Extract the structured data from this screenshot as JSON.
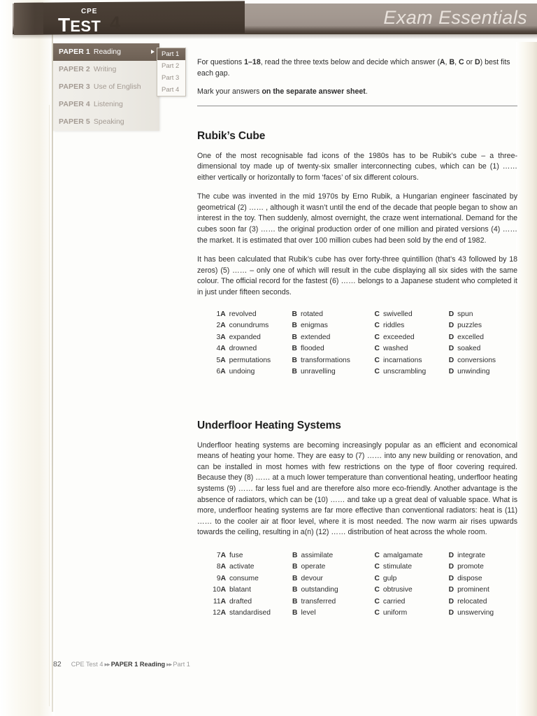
{
  "banner": {
    "cpe_label": "CPE",
    "test_word": "TEST",
    "test_number": "4",
    "title": "Exam Essentials"
  },
  "nav": {
    "items": [
      {
        "number": "PAPER 1",
        "name": "Reading",
        "active": true
      },
      {
        "number": "PAPER 2",
        "name": "Writing",
        "active": false
      },
      {
        "number": "PAPER 3",
        "name": "Use of English",
        "active": false
      },
      {
        "number": "PAPER 4",
        "name": "Listening",
        "active": false
      },
      {
        "number": "PAPER 5",
        "name": "Speaking",
        "active": false
      }
    ],
    "submenu": [
      {
        "label": "Part 1",
        "active": true
      },
      {
        "label": "Part 2",
        "active": false
      },
      {
        "label": "Part 3",
        "active": false
      },
      {
        "label": "Part 4",
        "active": false
      }
    ]
  },
  "instructions": {
    "line1_pre": "For questions ",
    "line1_bold": "1–18",
    "line1_mid": ", read the three texts below and decide which answer (",
    "line1_a": "A",
    "line1_b": "B",
    "line1_c": "C",
    "line1_d": "D",
    "line1_post": ") best fits each gap.",
    "line2_pre": "Mark your answers ",
    "line2_bold": "on the separate answer sheet",
    "line2_post": "."
  },
  "sections": [
    {
      "heading": "Rubik’s Cube",
      "paragraphs": [
        "One of the most recognisable fad icons of the 1980s has to be Rubik’s cube – a three-dimensional toy made up of twenty-six smaller interconnecting cubes, which can be (1) …… either vertically or horizontally to form ‘faces’ of six different colours.",
        "The cube was invented in the mid 1970s by Erno Rubik, a Hungarian engineer fascinated by geometrical (2) …… , although it wasn’t until the end of the decade that people began to show an interest in the toy. Then suddenly, almost overnight, the craze went international. Demand for the cubes soon far (3) …… the original production order of one million and pirated versions (4) …… the market. It is estimated that over 100 million cubes had been sold by the end of 1982.",
        "It has been calculated that Rubik’s cube has over forty-three quintillion (that’s 43 followed by 18 zeros) (5) …… – only one of which will result in the cube displaying all six sides with the same colour. The official record for the fastest (6) …… belongs to a Japanese student who completed it in just under fifteen seconds."
      ],
      "options": [
        {
          "n": "1",
          "A": "revolved",
          "B": "rotated",
          "C": "swivelled",
          "D": "spun"
        },
        {
          "n": "2",
          "A": "conundrums",
          "B": "enigmas",
          "C": "riddles",
          "D": "puzzles"
        },
        {
          "n": "3",
          "A": "expanded",
          "B": "extended",
          "C": "exceeded",
          "D": "excelled"
        },
        {
          "n": "4",
          "A": "drowned",
          "B": "flooded",
          "C": "washed",
          "D": "soaked"
        },
        {
          "n": "5",
          "A": "permutations",
          "B": "transformations",
          "C": "incarnations",
          "D": "conversions"
        },
        {
          "n": "6",
          "A": "undoing",
          "B": "unravelling",
          "C": "unscrambling",
          "D": "unwinding"
        }
      ]
    },
    {
      "heading": "Underfloor Heating Systems",
      "paragraphs": [
        "Underfloor heating systems are becoming increasingly popular as an efficient and economical means of heating your home. They are easy to (7) …… into any new building or renovation, and can be installed in most homes with few restrictions on the type of floor covering required. Because they (8) …… at a much lower temperature than conventional heating, underfloor heating systems (9) …… far less fuel and are therefore also more eco-friendly. Another advantage is the absence of radiators, which can be (10) …… and take up a great deal of valuable space. What is more, underfloor heating systems are far more effective than conventional radiators: heat is (11) …… to the cooler air at floor level, where it is most needed. The now warm air rises upwards towards the ceiling, resulting in a(n) (12) …… distribution of heat across the whole room."
      ],
      "options": [
        {
          "n": "7",
          "A": "fuse",
          "B": "assimilate",
          "C": "amalgamate",
          "D": "integrate"
        },
        {
          "n": "8",
          "A": "activate",
          "B": "operate",
          "C": "stimulate",
          "D": "promote"
        },
        {
          "n": "9",
          "A": "consume",
          "B": "devour",
          "C": "gulp",
          "D": "dispose"
        },
        {
          "n": "10",
          "A": "blatant",
          "B": "outstanding",
          "C": "obtrusive",
          "D": "prominent"
        },
        {
          "n": "11",
          "A": "drafted",
          "B": "transferred",
          "C": "carried",
          "D": "relocated"
        },
        {
          "n": "12",
          "A": "standardised",
          "B": "level",
          "C": "uniform",
          "D": "unswerving"
        }
      ]
    }
  ],
  "footer": {
    "page": "82",
    "test": "CPE Test 4",
    "paper": "PAPER 1",
    "skill": "Reading",
    "part": "Part 1",
    "chevron": "▸▸"
  }
}
